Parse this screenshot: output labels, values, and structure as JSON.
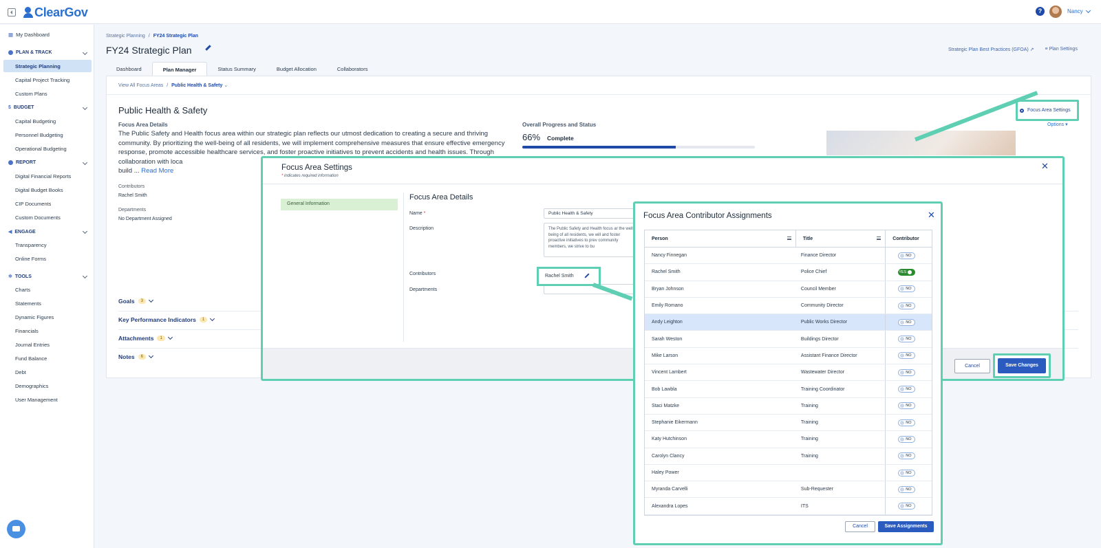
{
  "app": {
    "logo_text": "ClearGov",
    "user_name": "Nancy",
    "help_label": "?"
  },
  "sidebar": {
    "dashboard": "My Dashboard",
    "sections": [
      {
        "title": "PLAN & TRACK",
        "items": [
          "Strategic Planning",
          "Capital Project Tracking",
          "Custom Plans"
        ]
      },
      {
        "title": "BUDGET",
        "items": [
          "Capital Budgeting",
          "Personnel Budgeting",
          "Operational Budgeting"
        ]
      },
      {
        "title": "REPORT",
        "items": [
          "Digital Financial Reports",
          "Digital Budget Books",
          "CIP Documents",
          "Custom Documents"
        ]
      },
      {
        "title": "ENGAGE",
        "items": [
          "Transparency",
          "Online Forms"
        ]
      },
      {
        "title": "TOOLS",
        "items": [
          "Charts",
          "Statements",
          "Dynamic Figures",
          "Financials",
          "Journal Entries",
          "Fund Balance",
          "Debt",
          "Demographics",
          "User Management"
        ]
      }
    ],
    "active_item": "Strategic Planning"
  },
  "breadcrumb": {
    "parent": "Strategic Planning",
    "sep": "/",
    "current": "FY24 Strategic Plan"
  },
  "page": {
    "title": "FY24 Strategic Plan",
    "link_best_practices": "Strategic Plan Best Practices (GFOA)",
    "link_plan_settings": "Plan Settings",
    "tabs": [
      "Dashboard",
      "Plan Manager",
      "Status Summary",
      "Budget Allocation",
      "Collaborators"
    ],
    "active_tab": "Plan Manager"
  },
  "focus_area": {
    "crumb_all": "View All Focus Areas",
    "crumb_current": "Public Health & Safety",
    "title": "Public Health & Safety",
    "details_label": "Focus Area Details",
    "description": "The Public Safety and Health focus area within our strategic plan reflects our utmost dedication to creating a secure and thriving community. By prioritizing the well-being of all residents, we will implement comprehensive measures that ensure effective emergency response, promote accessible healthcare services, and foster proactive initiatives to prevent accidents and health issues. Through collaboration with loca",
    "desc_tail": "build ...",
    "read_more": "Read More",
    "contributors_label": "Contributors",
    "contributors_value": "Rachel Smith",
    "departments_label": "Departments",
    "departments_value": "No Department Assigned",
    "progress_label": "Overall Progress and Status",
    "progress_pct_text": "66%",
    "progress_value": 66,
    "progress_status": "Complete",
    "settings_link": "Focus Area Settings",
    "options": "Options",
    "accordions": [
      {
        "label": "Goals",
        "count": "3"
      },
      {
        "label": "Key Performance Indicators",
        "count": "1"
      },
      {
        "label": "Attachments",
        "count": "1"
      },
      {
        "label": "Notes",
        "count": "6"
      }
    ]
  },
  "settings_modal": {
    "title": "Focus Area Settings",
    "required_note": "indicates required information",
    "nav_item": "General Information",
    "section_title": "Focus Area Details",
    "name_label": "Name",
    "name_value": "Public Health & Safety",
    "description_label": "Description",
    "description_value": "The Public Safety and Health focus ar the well-being of all residents, we will and foster proactive initiatives to prev community members, we strive to bu",
    "contributors_label": "Contributors",
    "contributors_value": "Rachel Smith",
    "departments_label": "Departments",
    "cancel": "Cancel",
    "save": "Save Changes"
  },
  "contributor_modal": {
    "title": "Focus Area Contributor Assignments",
    "columns": [
      "Person",
      "Title",
      "Contributor"
    ],
    "rows": [
      {
        "person": "Nancy Finnegan",
        "title": "Finance Director",
        "contributor": "NO"
      },
      {
        "person": "Rachel Smith",
        "title": "Police Chief",
        "contributor": "YES"
      },
      {
        "person": "Bryan Johnson",
        "title": "Council Member",
        "contributor": "NO"
      },
      {
        "person": "Emily Romano",
        "title": "Community Director",
        "contributor": "NO"
      },
      {
        "person": "Andy Leighton",
        "title": "Public Works Director",
        "contributor": "NO"
      },
      {
        "person": "Sarah Weston",
        "title": "Buildings Director",
        "contributor": "NO"
      },
      {
        "person": "Mike Larson",
        "title": "Assistant Finance Director",
        "contributor": "NO"
      },
      {
        "person": "Vincent Lambert",
        "title": "Wastewater Director",
        "contributor": "NO"
      },
      {
        "person": "Bob Lawbla",
        "title": "Training Coordinator",
        "contributor": "NO"
      },
      {
        "person": "Staci Matzke",
        "title": "Training",
        "contributor": "NO"
      },
      {
        "person": "Stephanie Eikermann",
        "title": "Training",
        "contributor": "NO"
      },
      {
        "person": "Katy Hutchinson",
        "title": "Training",
        "contributor": "NO"
      },
      {
        "person": "Carolyn Clancy",
        "title": "Training",
        "contributor": "NO"
      },
      {
        "person": "Haley Power",
        "title": "",
        "contributor": "NO"
      },
      {
        "person": "Myranda Carvelli",
        "title": "Sub-Requester",
        "contributor": "NO"
      },
      {
        "person": "Alexandra Lopes",
        "title": "ITS",
        "contributor": "NO"
      }
    ],
    "highlighted_row": "Andy Leighton",
    "cancel": "Cancel",
    "save": "Save Assignments"
  },
  "colors": {
    "brand": "#2b6fcf",
    "callout": "#5fcfb3",
    "primary_button": "#2b5bbf",
    "toggle_on": "#2a8c2e"
  }
}
